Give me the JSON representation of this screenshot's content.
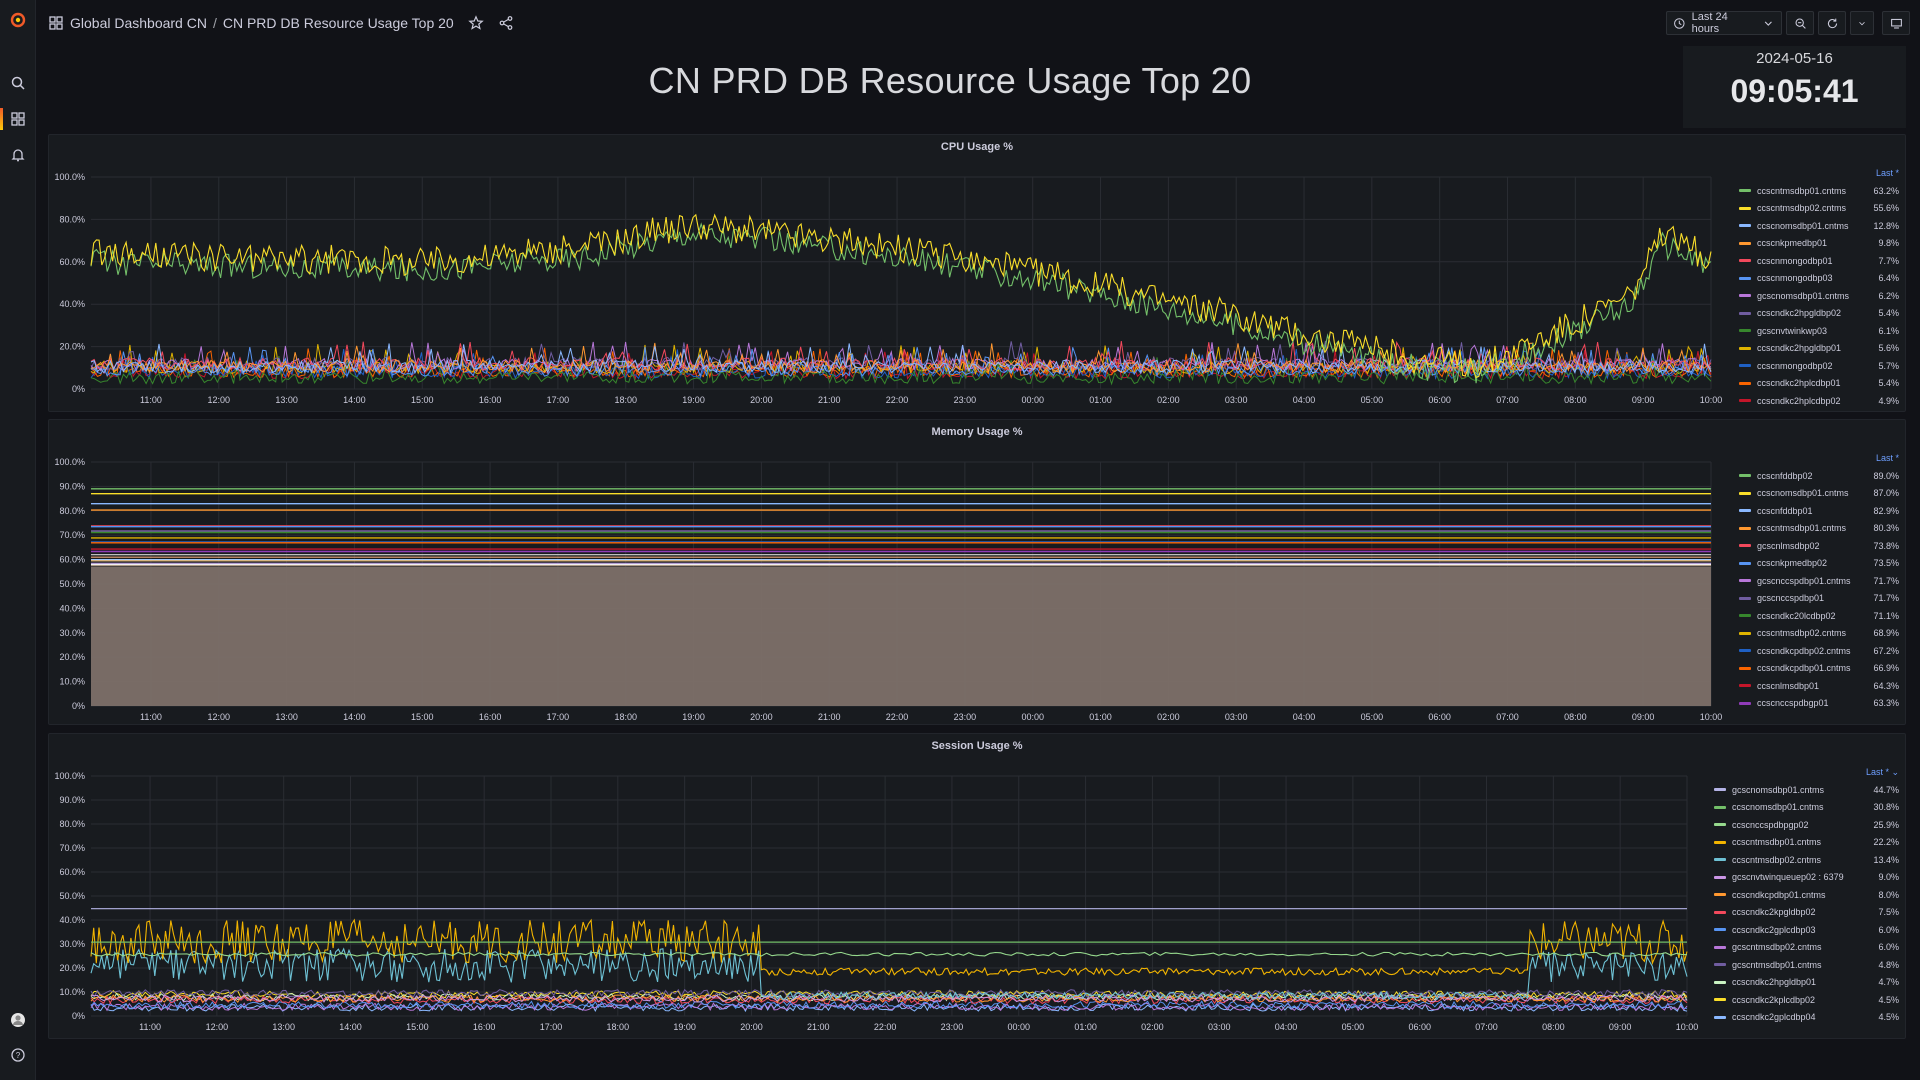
{
  "breadcrumb": {
    "folder": "Global Dashboard CN",
    "separator": "/",
    "dashboard": "CN PRD DB Resource Usage Top 20"
  },
  "toolbar": {
    "time_range": "Last 24 hours"
  },
  "title": "CN PRD DB Resource Usage Top 20",
  "clock": {
    "date": "2024-05-16",
    "time": "09:05:41"
  },
  "icons": {
    "sidebar": [
      "grafana-logo-icon",
      "search-icon",
      "dashboards-icon",
      "alerting-bell-icon",
      "user-avatar-icon",
      "help-icon"
    ],
    "topbar": [
      "dashboards-icon",
      "star-icon",
      "share-icon",
      "clock-icon",
      "chevron-down-icon",
      "zoom-out-icon",
      "refresh-icon",
      "tv-mode-icon"
    ]
  },
  "colors": {
    "accent": "#f05a28",
    "legend_header": "#6e9fff",
    "panel_bg": "#181b1f"
  },
  "x_ticks": [
    "11:00",
    "12:00",
    "13:00",
    "14:00",
    "15:00",
    "16:00",
    "17:00",
    "18:00",
    "19:00",
    "20:00",
    "21:00",
    "22:00",
    "23:00",
    "00:00",
    "01:00",
    "02:00",
    "03:00",
    "04:00",
    "05:00",
    "06:00",
    "07:00",
    "08:00",
    "09:00",
    "10:00"
  ],
  "panels": {
    "cpu": {
      "title": "CPU Usage %",
      "legend_header": "Last *",
      "y_ticks": [
        "0%",
        "20.0%",
        "40.0%",
        "60.0%",
        "80.0%",
        "100.0%"
      ],
      "legend": [
        {
          "name": "ccscntmsdbp01.cntms",
          "value": "63.2%",
          "color": "#73bf69"
        },
        {
          "name": "ccscntmsdbp02.cntms",
          "value": "55.6%",
          "color": "#fade2a"
        },
        {
          "name": "ccscnomsdbp01.cntms",
          "value": "12.8%",
          "color": "#8ab8ff"
        },
        {
          "name": "ccscnkpmedbp01",
          "value": "9.8%",
          "color": "#ff9830"
        },
        {
          "name": "ccscnmongodbp01",
          "value": "7.7%",
          "color": "#f2495c"
        },
        {
          "name": "ccscnmongodbp03",
          "value": "6.4%",
          "color": "#5794f2"
        },
        {
          "name": "gcscnomsdbp01.cntms",
          "value": "6.2%",
          "color": "#b877d9"
        },
        {
          "name": "ccscndkc2hpgldbp02",
          "value": "5.4%",
          "color": "#705da0"
        },
        {
          "name": "gcscnvtwinkwp03",
          "value": "6.1%",
          "color": "#37872d"
        },
        {
          "name": "ccscndkc2hpgldbp01",
          "value": "5.6%",
          "color": "#e0b400"
        },
        {
          "name": "ccscnmongodbp02",
          "value": "5.7%",
          "color": "#1f60c4"
        },
        {
          "name": "ccscndkc2hplcdbp01",
          "value": "5.4%",
          "color": "#fa6400"
        },
        {
          "name": "ccscndkc2hplcdbp02",
          "value": "4.9%",
          "color": "#c4162a"
        }
      ]
    },
    "memory": {
      "title": "Memory Usage %",
      "legend_header": "Last *",
      "y_ticks": [
        "0%",
        "10.0%",
        "20.0%",
        "30.0%",
        "40.0%",
        "50.0%",
        "60.0%",
        "70.0%",
        "80.0%",
        "90.0%",
        "100.0%"
      ],
      "legend": [
        {
          "name": "ccscnfddbp02",
          "value": "89.0%",
          "color": "#73bf69"
        },
        {
          "name": "ccscnomsdbp01.cntms",
          "value": "87.0%",
          "color": "#fade2a"
        },
        {
          "name": "ccscnfddbp01",
          "value": "82.9%",
          "color": "#8ab8ff"
        },
        {
          "name": "ccscntmsdbp01.cntms",
          "value": "80.3%",
          "color": "#ff9830"
        },
        {
          "name": "gcscnlmsdbp02",
          "value": "73.8%",
          "color": "#f2495c"
        },
        {
          "name": "ccscnkpmedbp02",
          "value": "73.5%",
          "color": "#5794f2"
        },
        {
          "name": "gcscnccspdbp01.cntms",
          "value": "71.7%",
          "color": "#b877d9"
        },
        {
          "name": "gcscnccspdbp01",
          "value": "71.7%",
          "color": "#705da0"
        },
        {
          "name": "ccscndkc20lcdbp02",
          "value": "71.1%",
          "color": "#37872d"
        },
        {
          "name": "ccscntmsdbp02.cntms",
          "value": "68.9%",
          "color": "#e0b400"
        },
        {
          "name": "ccscndkcpdbp02.cntms",
          "value": "67.2%",
          "color": "#1f60c4"
        },
        {
          "name": "ccscndkcpdbp01.cntms",
          "value": "66.9%",
          "color": "#fa6400"
        },
        {
          "name": "ccscnlmsdbp01",
          "value": "64.3%",
          "color": "#c4162a"
        },
        {
          "name": "ccscnccspdbgp01",
          "value": "63.3%",
          "color": "#8f3bb8"
        }
      ]
    },
    "session": {
      "title": "Session Usage %",
      "legend_header": "Last * ⌄",
      "y_ticks": [
        "0%",
        "10.0%",
        "20.0%",
        "30.0%",
        "40.0%",
        "50.0%",
        "60.0%",
        "70.0%",
        "80.0%",
        "90.0%",
        "100.0%"
      ],
      "legend": [
        {
          "name": "gcscnomsdbp01.cntms",
          "value": "44.7%",
          "color": "#b4b3e6"
        },
        {
          "name": "ccscnomsdbp01.cntms",
          "value": "30.8%",
          "color": "#73bf69"
        },
        {
          "name": "ccscnccspdbpgp02",
          "value": "25.9%",
          "color": "#96d98d"
        },
        {
          "name": "ccscntmsdbp01.cntms",
          "value": "22.2%",
          "color": "#f2b400"
        },
        {
          "name": "ccscntmsdbp02.cntms",
          "value": "13.4%",
          "color": "#6ec1d4"
        },
        {
          "name": "gcscnvtwinqueuep02 : 6379",
          "value": "9.0%",
          "color": "#ca95e5"
        },
        {
          "name": "ccscndkcpdbp01.cntms",
          "value": "8.0%",
          "color": "#ff9830"
        },
        {
          "name": "ccscndkc2kpgldbp02",
          "value": "7.5%",
          "color": "#f2495c"
        },
        {
          "name": "ccscndkc2gplcdbp03",
          "value": "6.0%",
          "color": "#5794f2"
        },
        {
          "name": "gcscntmsdbp02.cntms",
          "value": "6.0%",
          "color": "#b877d9"
        },
        {
          "name": "gcscntmsdbp01.cntms",
          "value": "4.8%",
          "color": "#705da0"
        },
        {
          "name": "ccscndkc2hpgldbp01",
          "value": "4.7%",
          "color": "#c8f2c2"
        },
        {
          "name": "ccscndkc2kplcdbp02",
          "value": "4.5%",
          "color": "#fade2a"
        },
        {
          "name": "ccscndkc2gplcdbp04",
          "value": "4.5%",
          "color": "#8ab8ff"
        }
      ]
    }
  }
}
